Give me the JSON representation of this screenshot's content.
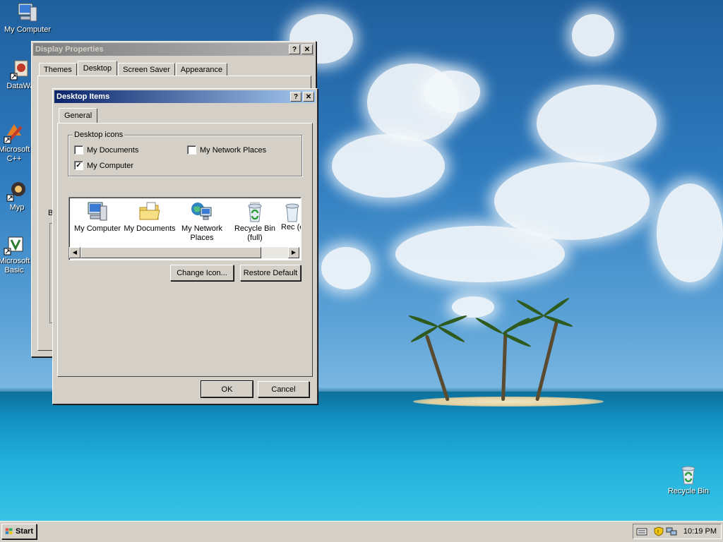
{
  "desktop": {
    "icons": [
      {
        "label": "My Computer"
      },
      {
        "label": "DataWa"
      },
      {
        "label": "Microsoft C++"
      },
      {
        "label": "Myp"
      },
      {
        "label": "Microsoft Basic"
      },
      {
        "label": "Recycle Bin"
      }
    ]
  },
  "display_properties": {
    "title": "Display Properties",
    "help_label": "?",
    "close_label": "✕",
    "tabs": [
      {
        "label": "Themes"
      },
      {
        "label": "Desktop"
      },
      {
        "label": "Screen Saver"
      },
      {
        "label": "Appearance"
      }
    ],
    "selected_tab": "Desktop",
    "partial_label": "B"
  },
  "desktop_items": {
    "title": "Desktop Items",
    "help_label": "?",
    "close_label": "✕",
    "tabs": [
      {
        "label": "General"
      }
    ],
    "group_label": "Desktop icons",
    "checkboxes": [
      {
        "label": "My Documents",
        "checked": false,
        "mark": ""
      },
      {
        "label": "My Network Places",
        "checked": false,
        "mark": ""
      },
      {
        "label": "My Computer",
        "checked": true,
        "mark": "✓"
      }
    ],
    "icon_list": [
      {
        "label": "My Computer",
        "icon": "my-computer-icon"
      },
      {
        "label": "My Documents",
        "icon": "my-documents-icon"
      },
      {
        "label": "My Network Places",
        "icon": "network-places-icon"
      },
      {
        "label": "Recycle Bin (full)",
        "icon": "recycle-bin-full-icon"
      },
      {
        "label": "Rec (e",
        "icon": "recycle-bin-empty-icon"
      }
    ],
    "change_icon_label": "Change Icon...",
    "restore_default_label": "Restore Default",
    "ok_label": "OK",
    "cancel_label": "Cancel"
  },
  "taskbar": {
    "start_label": "Start",
    "clock": "10:19 PM"
  }
}
